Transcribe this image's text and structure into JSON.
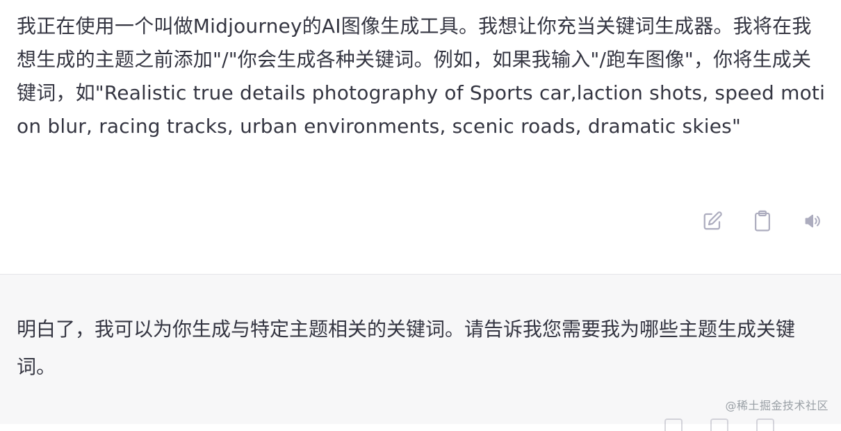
{
  "user_message": {
    "text": "我正在使用一个叫做Midjourney的AI图像生成工具。我想让你充当关键词生成器。我将在我想生成的主题之前添加\"/\"你会生成各种关键词。例如，如果我输入\"/跑车图像\"，你将生成关键词，如\"Realistic true details photography of Sports car,laction shots, speed motion blur, racing tracks, urban environments, scenic roads, dramatic skies\""
  },
  "actions": {
    "edit_icon": "edit-icon",
    "copy_icon": "clipboard-icon",
    "speak_icon": "speaker-icon"
  },
  "assistant_message": {
    "text": "明白了，我可以为你生成与特定主题相关的关键词。请告诉我您需要我为哪些主题生成关键词。"
  },
  "watermark": "@稀土掘金技术社区",
  "colors": {
    "text": "#343541",
    "icon": "#acacbe",
    "assistant_bg": "#f7f7f8",
    "divider": "#e5e5e9"
  }
}
